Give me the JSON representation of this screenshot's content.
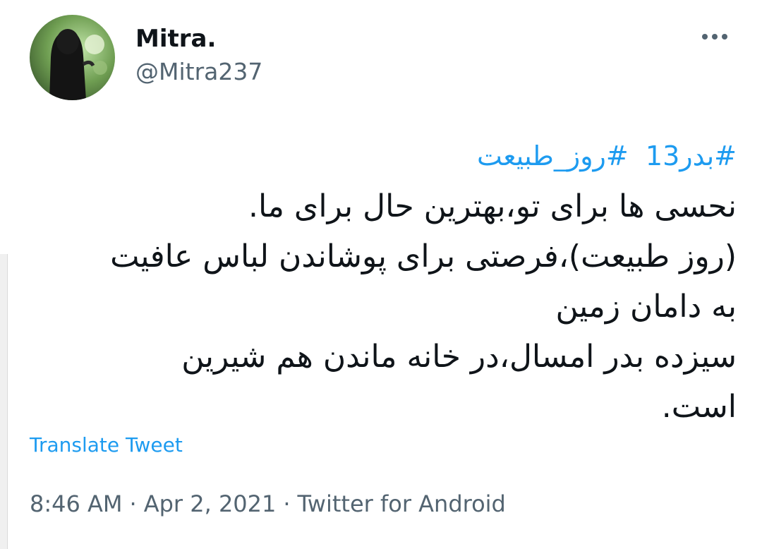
{
  "author": {
    "display_name": "Mitra.",
    "handle": "@Mitra237"
  },
  "menu": {
    "more_icon": "more-horizontal-icon"
  },
  "tweet": {
    "hashtags": [
      "#بدر13",
      "#روز_طبیعت"
    ],
    "lines": [
      "نحسی ها برای تو،بهترین حال برای ما.",
      "(روز طبیعت)،فرصتی برای پوشاندن لباس عافیت",
      "به دامان زمین",
      "سیزده بدر امسال،در خانه ماندن هم شیرین",
      "است."
    ]
  },
  "translate_label": "Translate Tweet",
  "meta": {
    "time": "8:46 AM",
    "separator": "·",
    "date": "Apr 2, 2021",
    "source": "Twitter for Android"
  },
  "colors": {
    "link": "#1d9bf0",
    "secondary_text": "#536471",
    "primary_text": "#0f1419"
  }
}
